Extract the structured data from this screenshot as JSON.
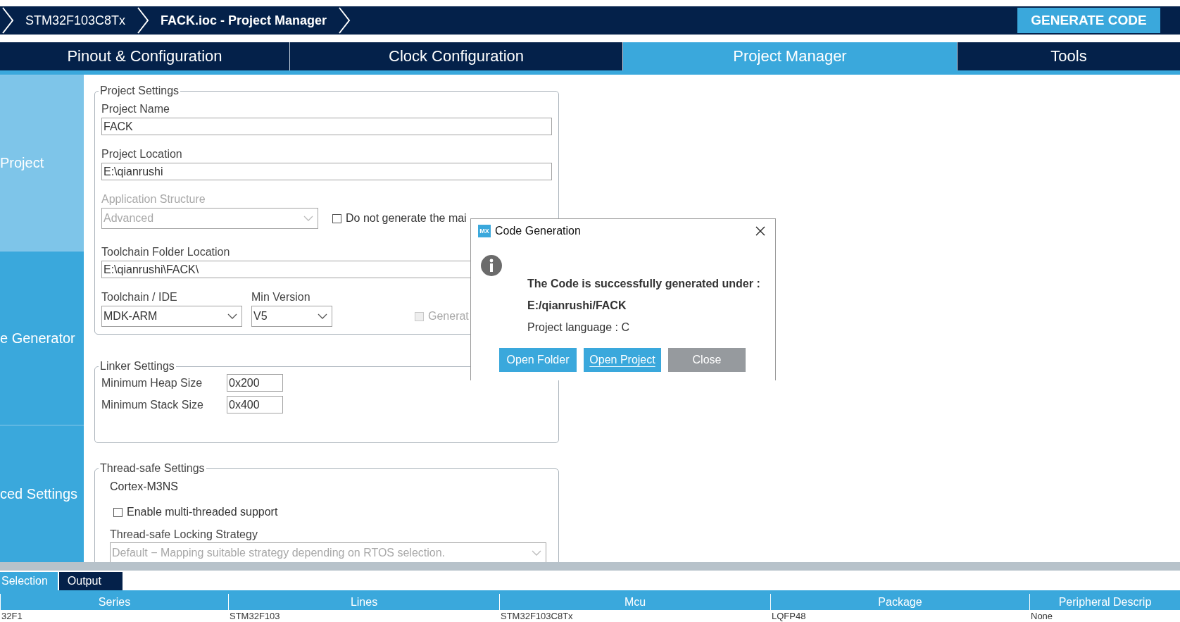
{
  "breadcrumbs": [
    {
      "label": "STM32F103C8Tx",
      "current": false
    },
    {
      "label": "FACK.ioc - Project Manager",
      "current": true
    }
  ],
  "generate_button": "GENERATE CODE",
  "tabs": [
    {
      "label": "Pinout & Configuration",
      "selected": false
    },
    {
      "label": "Clock Configuration",
      "selected": false
    },
    {
      "label": "Project Manager",
      "selected": true
    },
    {
      "label": "Tools",
      "selected": false
    }
  ],
  "sidebar": [
    {
      "label": "Project",
      "selected": true
    },
    {
      "label": "e Generator",
      "selected": false
    },
    {
      "label": "ced Settings",
      "selected": false
    }
  ],
  "project_settings": {
    "title": "Project Settings",
    "project_name": {
      "label": "Project Name",
      "value": "FACK"
    },
    "project_location": {
      "label": "Project Location",
      "value": "E:\\qianrushi"
    },
    "application_structure": {
      "label": "Application Structure",
      "value": "Advanced",
      "disabled": true
    },
    "no_main": {
      "label": "Do not generate the mai",
      "checked": false
    },
    "toolchain_folder": {
      "label": "Toolchain Folder Location",
      "value": "E:\\qianrushi\\FACK\\"
    },
    "toolchain": {
      "label": "Toolchain / IDE",
      "value": "MDK-ARM"
    },
    "min_version": {
      "label": "Min Version",
      "value": "V5"
    },
    "generate_root": {
      "label": "Generat",
      "checked": false,
      "disabled": true
    }
  },
  "linker_settings": {
    "title": "Linker Settings",
    "fields": [
      {
        "label": "Minimum Heap Size",
        "value": "0x200"
      },
      {
        "label": "Minimum Stack Size",
        "value": "0x400"
      }
    ]
  },
  "thread_safe_settings": {
    "title": "Thread-safe Settings",
    "core": "Cortex-M3NS",
    "multi_threaded": {
      "label": "Enable multi-threaded support",
      "checked": false
    },
    "strategy": {
      "label": "Thread-safe Locking Strategy",
      "value": "Default  −  Mapping suitable strategy depending on RTOS selection.",
      "disabled": true
    }
  },
  "dialog": {
    "logo": "MX",
    "title": "Code Generation",
    "message": "The Code is successfully generated under :",
    "path": "E:/qianrushi/FACK",
    "language": "Project language : C",
    "buttons": [
      {
        "label": "Open Folder",
        "kind": "primary",
        "focused": false
      },
      {
        "label": "Open Project",
        "kind": "primary",
        "focused": true
      },
      {
        "label": "Close",
        "kind": "neutral",
        "focused": false
      }
    ]
  },
  "bottom_tabs": [
    {
      "label": "Selection",
      "selected": true
    },
    {
      "label": "Output",
      "selected": false
    }
  ],
  "table": {
    "columns": [
      "Series",
      "Lines",
      "Mcu",
      "Package",
      "Peripheral Descrip"
    ],
    "rows": [
      [
        "32F1",
        "STM32F103",
        "STM32F103C8Tx",
        "LQFP48",
        "None"
      ]
    ]
  }
}
